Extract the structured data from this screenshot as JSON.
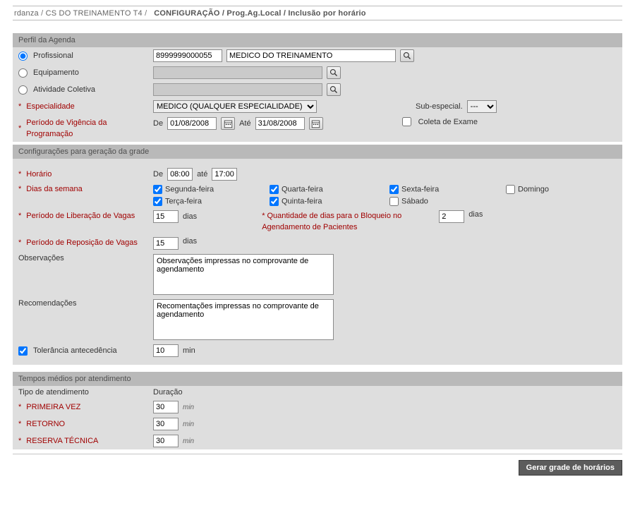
{
  "breadcrumb": {
    "user": "rdanza",
    "unit": "CS DO TREINAMENTO T4",
    "section": "CONFIGURAÇÃO",
    "subsection": "Prog.Ag.Local",
    "page": "Inclusão por horário"
  },
  "section_headers": {
    "perfil": "Perfil da Agenda",
    "config": "Configurações para geração da grade",
    "tempos": "Tempos médios por atendimento"
  },
  "perfil": {
    "profissional_label": "Profissional",
    "profissional_code": "8999999000055",
    "profissional_name": "MEDICO DO TREINAMENTO",
    "equipamento_label": "Equipamento",
    "equipamento_value": "",
    "atividade_label": "Atividade Coletiva",
    "atividade_value": "",
    "especialidade_label": "Especialidade",
    "especialidade_value": "MEDICO (QUALQUER ESPECIALIDADE)",
    "subespec_label": "Sub-especial.",
    "subespec_value": "---",
    "periodo_vig_label": "Período de Vigência da Programação",
    "de_label": "De",
    "ate_label": "Até",
    "vig_de": "01/08/2008",
    "vig_ate": "31/08/2008",
    "coleta_label": "Coleta de Exame"
  },
  "config": {
    "horario_label": "Horário",
    "de_label": "De",
    "ate_label": "até",
    "hora_de": "08:00",
    "hora_ate": "17:00",
    "dias_label": "Dias da semana",
    "seg": "Segunda-feira",
    "ter": "Terça-feira",
    "qua": "Quarta-feira",
    "qui": "Quinta-feira",
    "sex": "Sexta-feira",
    "sab": "Sábado",
    "dom": "Domingo",
    "lib_label": "Período de Liberação de Vagas",
    "lib_value": "15",
    "dias_txt": "dias",
    "bloq_label": "Quantidade de dias para o Bloqueio no Agendamento de Pacientes",
    "bloq_value": "2",
    "rep_label": "Período de Reposição de Vagas",
    "rep_value": "15",
    "obs_label": "Observações",
    "obs_value": "Observações impressas no comprovante de agendamento",
    "rec_label": "Recomendações",
    "rec_value": "Recomentações impressas no comprovante de agendamento",
    "tol_label": "Tolerância antecedência",
    "tol_value": "10",
    "min_txt": "min"
  },
  "tempos": {
    "tipo_header": "Tipo de atendimento",
    "dur_header": "Duração",
    "min_txt": "min",
    "rows": [
      {
        "label": "PRIMEIRA VEZ",
        "value": "30"
      },
      {
        "label": "RETORNO",
        "value": "30"
      },
      {
        "label": "RESERVA TÉCNICA",
        "value": "30"
      }
    ]
  },
  "buttons": {
    "gerar": "Gerar grade de horários"
  }
}
